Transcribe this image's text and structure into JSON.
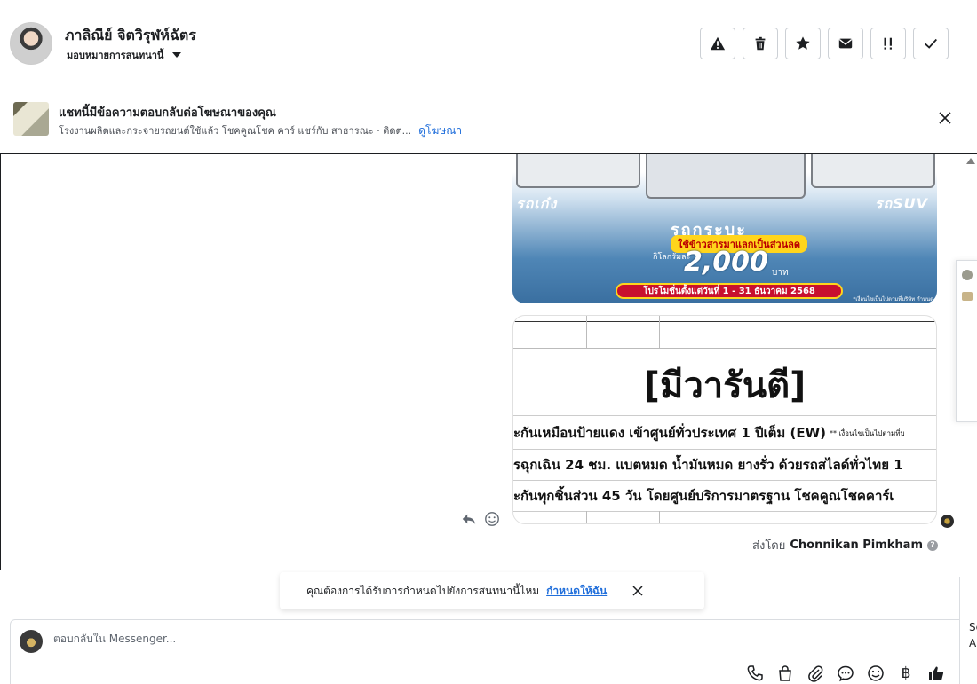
{
  "header": {
    "user_name": "ภาลิณีย์ จิตวิรุฬห์ฉัตร",
    "assign_label": "มอบหมายการสนทนานี้",
    "actions": [
      "warning",
      "trash",
      "star",
      "envelope",
      "priority",
      "check"
    ]
  },
  "ad_banner": {
    "title": "แชทนี้มีข้อความตอบกลับต่อโฆษณาของคุณ",
    "subtitle": "โรงงานผลิตและกระจายรถยนต์ใช้แล้ว โชคคูณโชค คาร์ แชร์กับ สาธารณะ · ดิดต...",
    "link": "ดูโฆษณา"
  },
  "car_ad": {
    "label_left": "รถเก๋ง",
    "label_right": "รถSUV",
    "center_label": "รถกระบะ",
    "promo_yellow": "ใช้ข้าวสารมาแลกเป็นส่วนลด",
    "promo_km": "กิโลกรัมละ",
    "promo_num": "2,000",
    "promo_baht": "บาท",
    "promo_red": "โปรโมชั่นตั้งแต่วันที่ 1 - 31 ธันวาคม 2568",
    "promo_note": "*เงื่อนไขเป็นไปตามที่บริษัท กำหนด"
  },
  "warranty": {
    "title": "[มีวารันตี]",
    "row1": "ะกันเหมือนป้ายแดง เข้าศูนย์ทั่วประเทศ 1 ปีเต็ม (EW)",
    "row1_note": "** เงื่อนไขเป็นไปตามที่บ",
    "row2": "รฉุกเฉิน 24 ชม. แบตหมด น้ำมันหมด ยางรั่ว ด้วยรถสไลด์ทั่วไทย 1",
    "row3": "ะกันทุกชิ้นส่วน 45 วัน โดยศูนย์บริการมาตรฐาน โชคคูณโชคคาร์เ"
  },
  "sent_by": {
    "prefix": "ส่งโดย",
    "name": "Chonnikan Pimkham",
    "help": "?"
  },
  "reminder": {
    "text": "คุณต้องการได้รับการกำหนดไปยังการสนทนานี้ไหม",
    "link": "กำหนดให้ฉัน"
  },
  "composer": {
    "placeholder": "ตอบกลับใน Messenger...",
    "baht_symbol": "฿"
  },
  "side_edge": {
    "line1": "Se",
    "line2": "A"
  }
}
